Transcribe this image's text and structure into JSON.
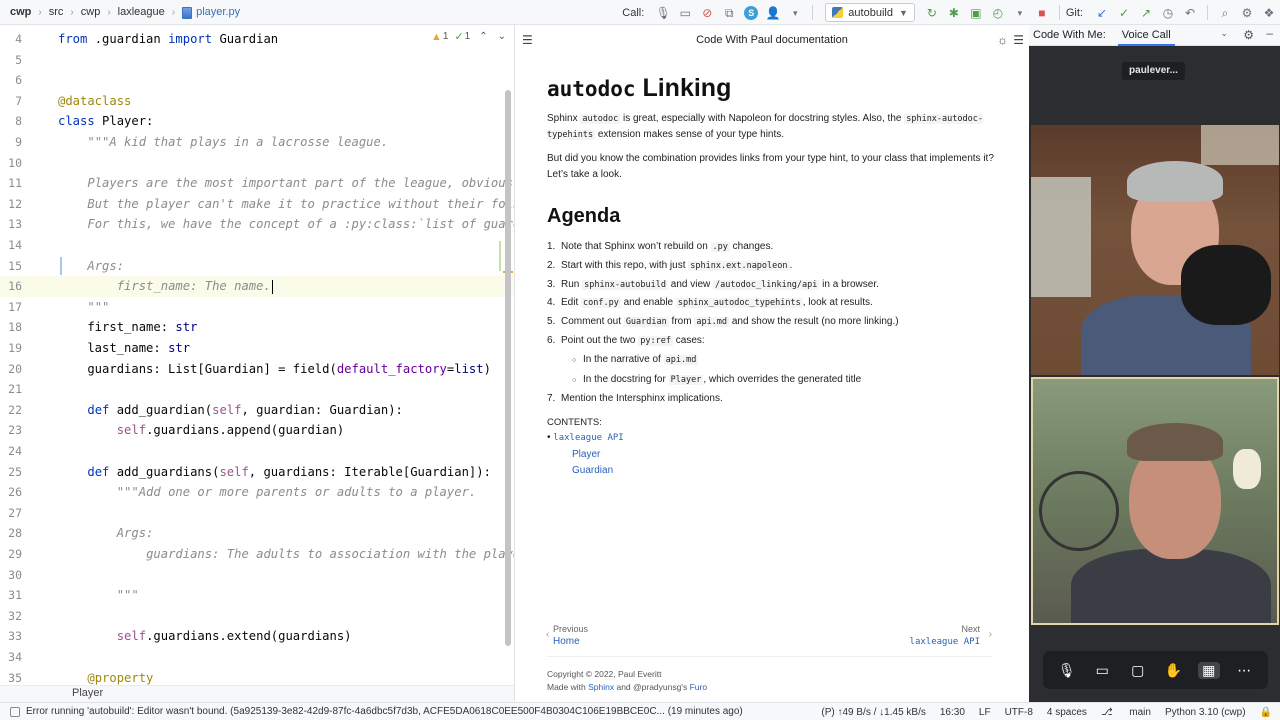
{
  "toolbar": {
    "breadcrumbs": [
      "cwp",
      "src",
      "cwp",
      "laxleague",
      "player.py"
    ],
    "call_label": "Call:",
    "avatar_letter": "S",
    "run_config": "autobuild",
    "git_label": "Git:"
  },
  "editor": {
    "warnings": "1",
    "checks": "1",
    "footer": "Player",
    "lines": [
      {
        "n": "4",
        "html": "<span class='kw'>from</span> .guardian <span class='kw'>import</span> Guardian"
      },
      {
        "n": "5",
        "html": ""
      },
      {
        "n": "6",
        "html": ""
      },
      {
        "n": "7",
        "html": "<span class='dec'>@dataclass</span>"
      },
      {
        "n": "8",
        "html": "<span class='kw'>class</span> Player:"
      },
      {
        "n": "9",
        "html": "    <span class='doc'>\"\"\"A kid that plays in a lacrosse league.</span>"
      },
      {
        "n": "10",
        "html": ""
      },
      {
        "n": "11",
        "html": "    <span class='doc'>Players are the most important part of the league, obviously</span>"
      },
      {
        "n": "12",
        "html": "    <span class='doc'>But the player can't make it to practice without their folks</span>"
      },
      {
        "n": "13",
        "html": "    <span class='doc'>For this, we have the concept of a :py:class:`list of guardi</span>"
      },
      {
        "n": "14",
        "html": ""
      },
      {
        "n": "15",
        "html": "    <span class='doc'>Args:</span>"
      },
      {
        "n": "16",
        "html": "        <span class='doc'>first_name: The name.</span>"
      },
      {
        "n": "17",
        "html": "    <span class='doc'>\"\"\"</span>"
      },
      {
        "n": "18",
        "html": "    first_name: <span class='builtin'>str</span>"
      },
      {
        "n": "19",
        "html": "    last_name: <span class='builtin'>str</span>"
      },
      {
        "n": "20",
        "html": "    guardians: List[Guardian] = field(<span class='param'>default_factory</span>=<span class='builtin'>list</span>)"
      },
      {
        "n": "21",
        "html": ""
      },
      {
        "n": "22",
        "html": "    <span class='kw'>def</span> add_guardian(<span class='self'>self</span>, guardian: Guardian):"
      },
      {
        "n": "23",
        "html": "        <span class='self'>self</span>.guardians.append(guardian)"
      },
      {
        "n": "24",
        "html": ""
      },
      {
        "n": "25",
        "html": "    <span class='kw'>def</span> add_guardians(<span class='self'>self</span>, guardians: Iterable[Guardian]):"
      },
      {
        "n": "26",
        "html": "        <span class='doc'>\"\"\"Add one or more parents or adults to a player.</span>"
      },
      {
        "n": "27",
        "html": ""
      },
      {
        "n": "28",
        "html": "        <span class='doc'>Args:</span>"
      },
      {
        "n": "29",
        "html": "            <span class='doc'>guardians: The adults to association with the player</span>"
      },
      {
        "n": "30",
        "html": ""
      },
      {
        "n": "31",
        "html": "        <span class='doc'>\"\"\"</span>"
      },
      {
        "n": "32",
        "html": ""
      },
      {
        "n": "33",
        "html": "        <span class='self'>self</span>.guardians.extend(guardians)"
      },
      {
        "n": "34",
        "html": ""
      },
      {
        "n": "35",
        "html": "    <span class='dec'>@property</span>"
      }
    ]
  },
  "docs": {
    "header_title": "Code With Paul documentation",
    "h1_code": "autodoc",
    "h1_text": "Linking",
    "p1_a": "Sphinx ",
    "p1_code1": "autodoc",
    "p1_b": " is great, especially with Napoleon for docstring styles. Also, the ",
    "p1_code2": "sphinx-autodoc-typehints",
    "p1_c": " extension makes sense of your type hints.",
    "p2": "But did you know the combination provides links from your type hint, to your class that implements it? Let’s take a look.",
    "h2": "Agenda",
    "agenda": [
      {
        "num": "1.",
        "html": "Note that Sphinx won’t rebuild on <span class='code-inline'>.py</span> changes."
      },
      {
        "num": "2.",
        "html": "Start with this repo, with just <span class='code-inline'>sphinx.ext.napoleon</span>."
      },
      {
        "num": "3.",
        "html": "Run <span class='code-inline'>sphinx-autobuild</span> and view <span class='code-inline'>/autodoc_linking/api</span> in a browser."
      },
      {
        "num": "4.",
        "html": "Edit <span class='code-inline'>conf.py</span> and enable <span class='code-inline'>sphinx_autodoc_typehints</span>, look at results."
      },
      {
        "num": "5.",
        "html": "Comment out <span class='code-inline'>Guardian</span> from <span class='code-inline'>api.md</span> and show the result (no more linking.)"
      },
      {
        "num": "6.",
        "html": "Point out the two <span class='code-inline'>py:ref</span> cases:"
      },
      {
        "num": "○",
        "sub": true,
        "html": "In the narrative of <span class='code-inline'>api.md</span>"
      },
      {
        "num": "○",
        "sub": true,
        "html": "In the docstring for <span class='code-inline'>Player</span>, which overrides the generated title"
      },
      {
        "num": "7.",
        "html": "Mention the Intersphinx implications."
      }
    ],
    "contents_label": "CONTENTS:",
    "contents": [
      {
        "text": "laxleague API",
        "mono": true,
        "level": 1
      },
      {
        "text": "Player",
        "level": 2
      },
      {
        "text": "Guardian",
        "level": 2
      }
    ],
    "prev_label": "Previous",
    "prev_link": "Home",
    "next_label": "Next",
    "next_link": "laxleague API",
    "copyright_line1": "Copyright © 2022, Paul Everitt",
    "made_with": "Made with ",
    "sphinx": "Sphinx",
    "and_text": " and @pradyunsg's ",
    "furo": "Furo"
  },
  "cwm": {
    "tab1": "Code With Me:",
    "tab2": "Voice Call",
    "user": "paulever..."
  },
  "statusbar": {
    "message": "Error running 'autobuild': Editor wasn't bound. (5a925139-3e82-42d9-87fc-4a6dbc5f7d3b, ACFE5DA0618C0EE500F4B0304C106E19BBCE0C... (19 minutes ago)",
    "network": "(P) ↑49 B/s / ↓1.45 kB/s",
    "position": "16:30",
    "line_ending": "LF",
    "encoding": "UTF-8",
    "indent": "4 spaces",
    "branch": "main",
    "interpreter": "Python 3.10 (cwp)"
  }
}
